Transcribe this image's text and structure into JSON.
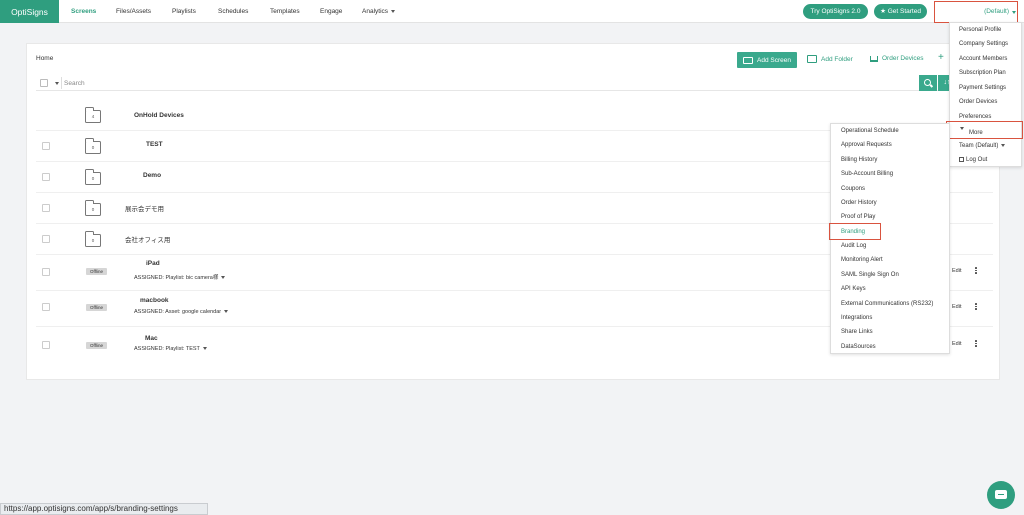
{
  "nav": {
    "logo": "OptiSigns",
    "items": [
      {
        "label": "Screens",
        "active": true
      },
      {
        "label": "Files/Assets"
      },
      {
        "label": "Playlists"
      },
      {
        "label": "Schedules"
      },
      {
        "label": "Templates"
      },
      {
        "label": "Engage"
      },
      {
        "label": "Analytics"
      }
    ],
    "try_button": "Try OptiSigns 2.0",
    "get_started": "★ Get Started",
    "account": "(Default)"
  },
  "toolbar": {
    "breadcrumb": "Home",
    "add_screen": "Add Screen",
    "add_folder": "Add Folder",
    "order_devices": "Order Devices",
    "plus": "+",
    "search_placeholder": "Search",
    "sort_icon": "↓↑"
  },
  "rows": [
    {
      "type": "folder",
      "count": "4",
      "name": "OnHold Devices"
    },
    {
      "type": "folder",
      "count": "0",
      "name": "TEST"
    },
    {
      "type": "folder",
      "count": "0",
      "name": "Demo"
    },
    {
      "type": "folder",
      "count": "0",
      "name": "展示会デモ用"
    },
    {
      "type": "folder",
      "count": "0",
      "name": "会社オフィス用"
    },
    {
      "type": "screen",
      "status": "Offline",
      "name": "iPad",
      "assigned": "ASSIGNED: Playlist: bic camera様",
      "edit": "Edit"
    },
    {
      "type": "screen",
      "status": "Offline",
      "name": "macbook",
      "assigned": "ASSIGNED: Asset: google calendar",
      "edit": "Edit"
    },
    {
      "type": "screen",
      "status": "Offline",
      "name": "Mac",
      "assigned": "ASSIGNED: Playlist: TEST",
      "edit": "Edit"
    }
  ],
  "account_menu": {
    "items": [
      "Personal Profile",
      "Company Settings",
      "Account Members",
      "Subscription Plan",
      "Payment Settings",
      "Order Devices",
      "Preferences"
    ],
    "more": "More",
    "team": "Team (Default)",
    "logout": "Log Out"
  },
  "more_menu": {
    "items": [
      "Operational Schedule",
      "Approval Requests",
      "Billing History",
      "Sub-Account Billing",
      "Coupons",
      "Order History",
      "Proof of Play",
      "Branding",
      "Audit Log",
      "Monitoring Alert",
      "SAML Single Sign On",
      "API Keys",
      "External Communications (RS232)",
      "Integrations",
      "Share Links",
      "DataSources"
    ],
    "highlighted": "Branding"
  },
  "status_bar": "https://app.optisigns.com/app/s/branding-settings",
  "colors": {
    "accent": "#2f9e7f",
    "highlight_border": "#d9533f"
  },
  "icons": [
    "monitor-icon",
    "folder-icon",
    "cart-icon",
    "search-icon",
    "sort-icon",
    "kebab-icon",
    "chat-icon",
    "logout-icon"
  ]
}
